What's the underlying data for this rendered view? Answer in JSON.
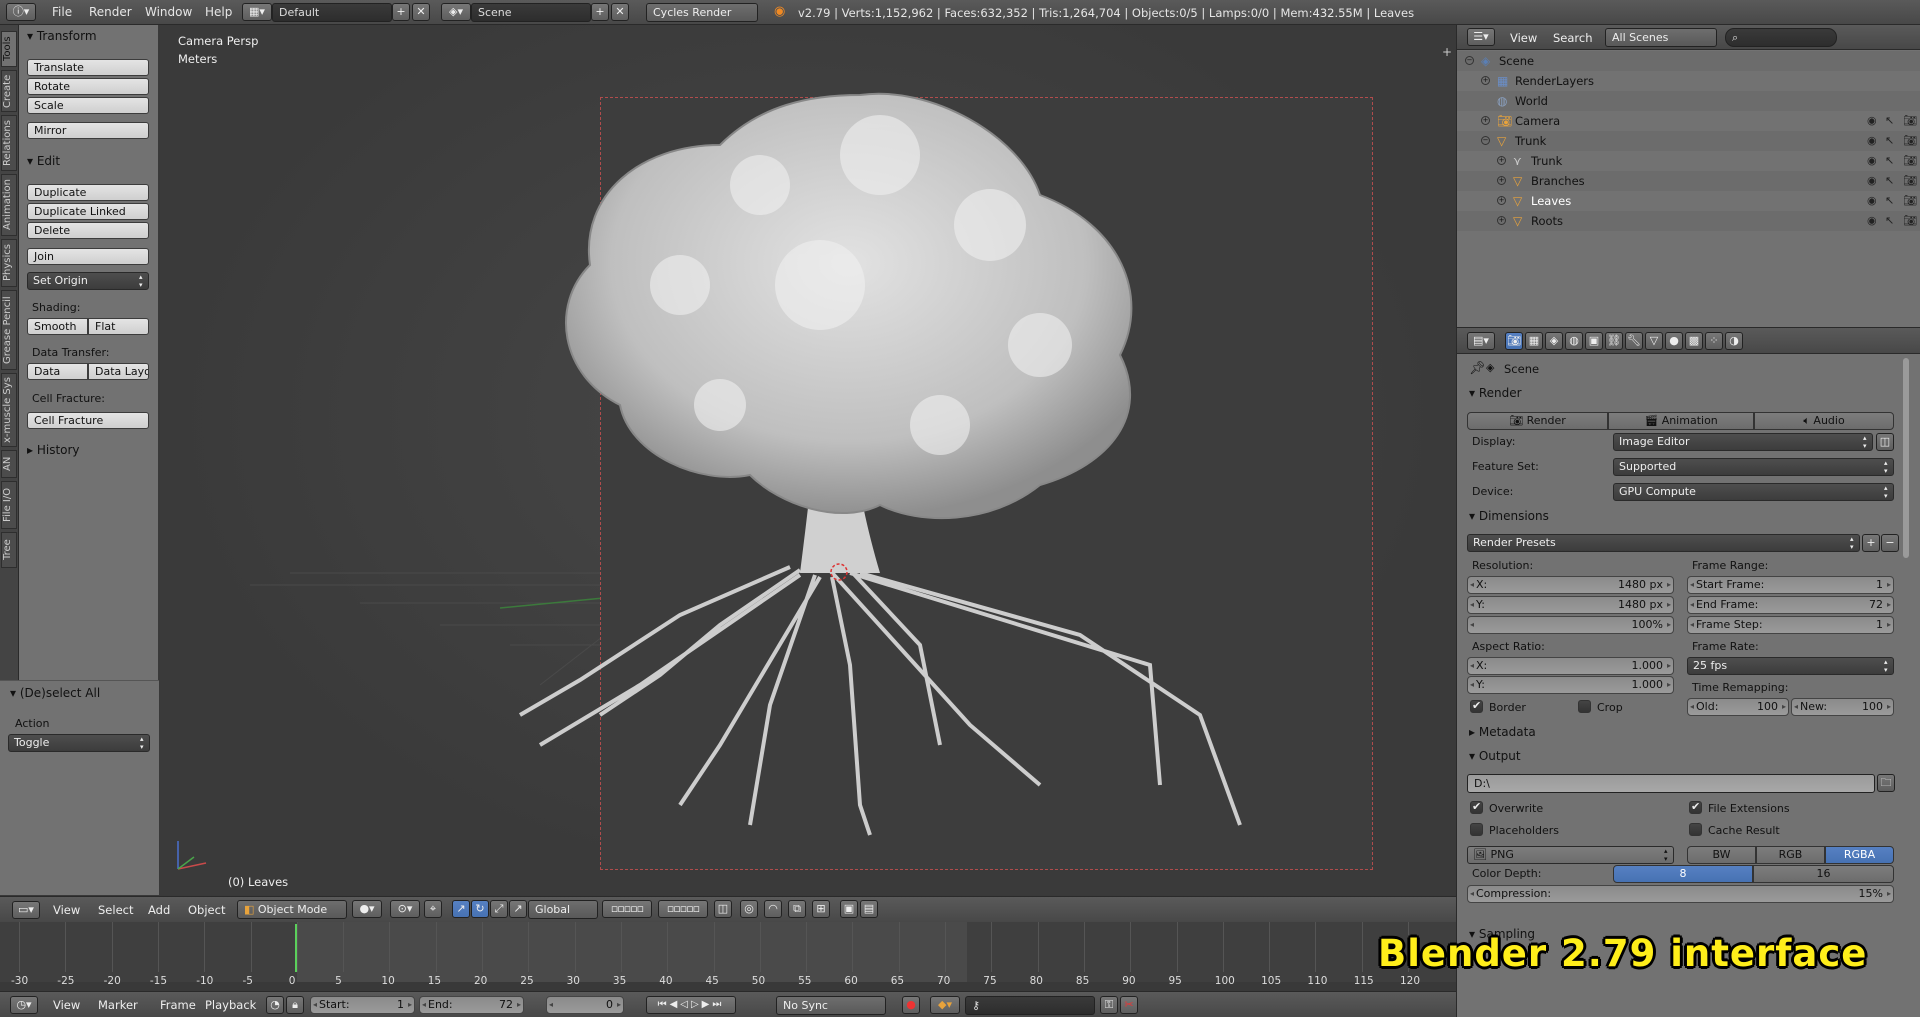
{
  "topbar": {
    "menus": [
      "File",
      "Render",
      "Window",
      "Help"
    ],
    "layout": "Default",
    "scene": "Scene",
    "engine": "Cycles Render",
    "stats": "v2.79 | Verts:1,152,962 | Faces:632,352 | Tris:1,264,704 | Objects:0/5 | Lamps:0/0 | Mem:432.55M | Leaves"
  },
  "side_tabs": [
    "Tools",
    "Create",
    "Relations",
    "Animation",
    "Physics",
    "Grease Pencil",
    "x-muscle Sys",
    "AN",
    "File I/O",
    "Tree"
  ],
  "tools": {
    "transform_header": "Transform",
    "translate": "Translate",
    "rotate": "Rotate",
    "scale": "Scale",
    "mirror": "Mirror",
    "edit_header": "Edit",
    "duplicate": "Duplicate",
    "duplicate_linked": "Duplicate Linked",
    "delete": "Delete",
    "join": "Join",
    "set_origin": "Set Origin",
    "shading_label": "Shading:",
    "smooth": "Smooth",
    "flat": "Flat",
    "data_transfer_label": "Data Transfer:",
    "data": "Data",
    "data_layo": "Data Layo",
    "cell_fracture_label": "Cell Fracture:",
    "cell_fracture": "Cell Fracture",
    "history_header": "History",
    "deselect_header": "(De)select All",
    "action_label": "Action",
    "action_value": "Toggle"
  },
  "viewport": {
    "view_name": "Camera Persp",
    "units": "Meters",
    "selected": "(0) Leaves"
  },
  "view_header": {
    "menus": [
      "View",
      "Select",
      "Add",
      "Object"
    ],
    "mode": "Object Mode",
    "orientation": "Global"
  },
  "timeline": {
    "ticks": [
      "-30",
      "-25",
      "-20",
      "-15",
      "-10",
      "-5",
      "0",
      "5",
      "10",
      "15",
      "20",
      "25",
      "30",
      "35",
      "40",
      "45",
      "50",
      "55",
      "60",
      "65",
      "70",
      "75",
      "80",
      "85",
      "90",
      "95",
      "100",
      "105",
      "110",
      "115",
      "120"
    ],
    "menus": [
      "View",
      "Marker",
      "Frame",
      "Playback"
    ],
    "start_label": "Start:",
    "start_value": "1",
    "end_label": "End:",
    "end_value": "72",
    "current_frame": "0",
    "sync": "No Sync"
  },
  "outliner": {
    "view": "View",
    "search": "Search",
    "scenes": "All Scenes",
    "items": [
      {
        "label": "Scene",
        "depth": 0
      },
      {
        "label": "RenderLayers",
        "depth": 1
      },
      {
        "label": "World",
        "depth": 1
      },
      {
        "label": "Camera",
        "depth": 1
      },
      {
        "label": "Trunk",
        "depth": 1
      },
      {
        "label": "Trunk",
        "depth": 2
      },
      {
        "label": "Branches",
        "depth": 2
      },
      {
        "label": "Leaves",
        "depth": 2
      },
      {
        "label": "Roots",
        "depth": 2
      }
    ]
  },
  "properties": {
    "context": "Scene",
    "render_header": "Render",
    "render_btn": "Render",
    "animation_btn": "Animation",
    "audio_btn": "Audio",
    "display_label": "Display:",
    "display_value": "Image Editor",
    "feature_label": "Feature Set:",
    "feature_value": "Supported",
    "device_label": "Device:",
    "device_value": "GPU Compute",
    "dimensions_header": "Dimensions",
    "render_presets": "Render Presets",
    "resolution_label": "Resolution:",
    "res_x_label": "X:",
    "res_x": "1480 px",
    "res_y_label": "Y:",
    "res_y": "1480 px",
    "res_pct": "100%",
    "frame_range_label": "Frame Range:",
    "start_frame_label": "Start Frame:",
    "start_frame": "1",
    "end_frame_label": "End Frame:",
    "end_frame": "72",
    "frame_step_label": "Frame Step:",
    "frame_step": "1",
    "aspect_label": "Aspect Ratio:",
    "asp_x_label": "X:",
    "asp_x": "1.000",
    "asp_y_label": "Y:",
    "asp_y": "1.000",
    "frame_rate_label": "Frame Rate:",
    "frame_rate": "25 fps",
    "time_remap_label": "Time Remapping:",
    "old_label": "Old:",
    "old_value": "100",
    "new_label": "New:",
    "new_value": "100",
    "border": "Border",
    "crop": "Crop",
    "metadata_header": "Metadata",
    "output_header": "Output",
    "output_path": "D:\\",
    "overwrite": "Overwrite",
    "file_extensions": "File Extensions",
    "placeholders": "Placeholders",
    "cache_result": "Cache Result",
    "format": "PNG",
    "bw": "BW",
    "rgb": "RGB",
    "rgba": "RGBA",
    "color_depth_label": "Color Depth:",
    "depth_8": "8",
    "depth_16": "16",
    "compression_label": "Compression:",
    "compression": "15%",
    "sampling_header": "Sampling"
  },
  "overlay_caption": "Blender 2.79 interface"
}
